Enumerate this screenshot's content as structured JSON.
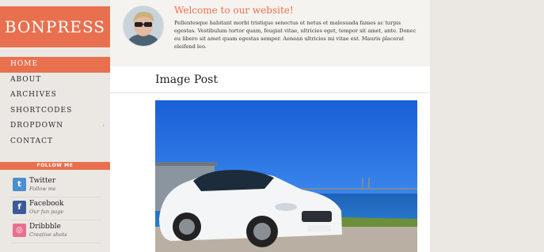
{
  "site": {
    "logo": "BONPRESS"
  },
  "nav": {
    "items": [
      {
        "label": "HOME",
        "active": true
      },
      {
        "label": "ABOUT"
      },
      {
        "label": "ARCHIVES"
      },
      {
        "label": "SHORTCODES"
      },
      {
        "label": "DROPDOWN",
        "has_submenu": true,
        "chevron": "›"
      },
      {
        "label": "CONTACT"
      }
    ]
  },
  "follow": {
    "title": "FOLLOW ME",
    "items": [
      {
        "name": "Twitter",
        "sub": "Follow me",
        "icon": "twitter-icon",
        "glyph": "t",
        "color": "#4a8fd0"
      },
      {
        "name": "Facebook",
        "sub": "Our fan page",
        "icon": "facebook-icon",
        "glyph": "f",
        "color": "#3b5b9a"
      },
      {
        "name": "Dribbble",
        "sub": "Creative shots",
        "icon": "dribbble-icon",
        "glyph": "◎",
        "color": "#e8708f"
      }
    ]
  },
  "header": {
    "welcome": "Welcome to our website!",
    "intro": "Pellentesque habitant morbi tristique senectus et netus et malesuada fames ac turpis egestas. Vestibulum tortor quam, feugiat vitae, ultricies eget, tempor sit amet, ante. Donec eu libero sit amet quam egestas semper. Aenean ultricies mi vitae est. Mauris placerat eleifend leo."
  },
  "post": {
    "title": "Image Post"
  },
  "colors": {
    "accent": "#e8704f",
    "sidebar_bg": "#ebe8e3",
    "header_bg": "#f5f3ef"
  }
}
